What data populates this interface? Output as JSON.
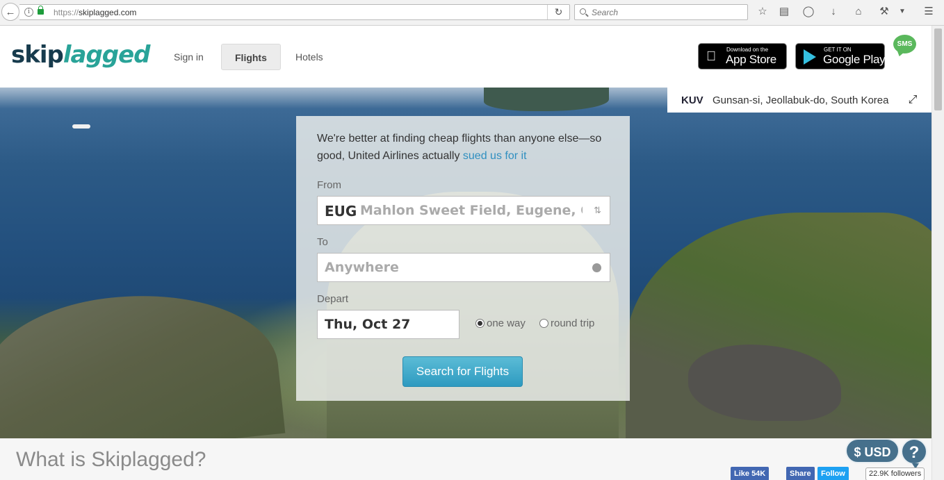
{
  "browser": {
    "url_scheme": "https://",
    "url_host": "skiplagged.com",
    "search_placeholder": "Search"
  },
  "header": {
    "logo_part1": "skip",
    "logo_part2": "lagged",
    "nav": [
      {
        "label": "Sign in"
      },
      {
        "label": "Flights"
      },
      {
        "label": "Hotels"
      }
    ],
    "app_store": {
      "small": "Download on the",
      "big": "App Store"
    },
    "google_play": {
      "small": "GET IT ON",
      "big": "Google Play"
    },
    "sms": "SMS"
  },
  "location": {
    "code": "KUV",
    "name": "Gunsan-si, Jeollabuk-do, South Korea"
  },
  "search": {
    "tagline_text": "We're better at finding cheap flights than anyone else—so good, United Airlines actually ",
    "tagline_link": "sued us for it",
    "from_label": "From",
    "from_code": "EUG",
    "from_name": "Mahlon Sweet Field, Eugene, OR",
    "to_label": "To",
    "to_placeholder": "Anywhere",
    "depart_label": "Depart",
    "depart_value": "Thu, Oct 27",
    "trip_one_way": "one way",
    "trip_round_trip": "round trip",
    "selected_trip": "one way",
    "button": "Search for Flights"
  },
  "footer": {
    "what_title": "What is Skiplagged?",
    "currency": "$ USD",
    "help": "?",
    "fb_like": "Like 54K",
    "fb_share": "Share",
    "tw_follow": "Follow",
    "tw_followers": "22.9K followers"
  },
  "colors": {
    "brand_dark": "#173b4d",
    "brand_teal": "#29a398",
    "button_blue": "#2e9ac0",
    "link_blue": "#2f8fc0"
  }
}
